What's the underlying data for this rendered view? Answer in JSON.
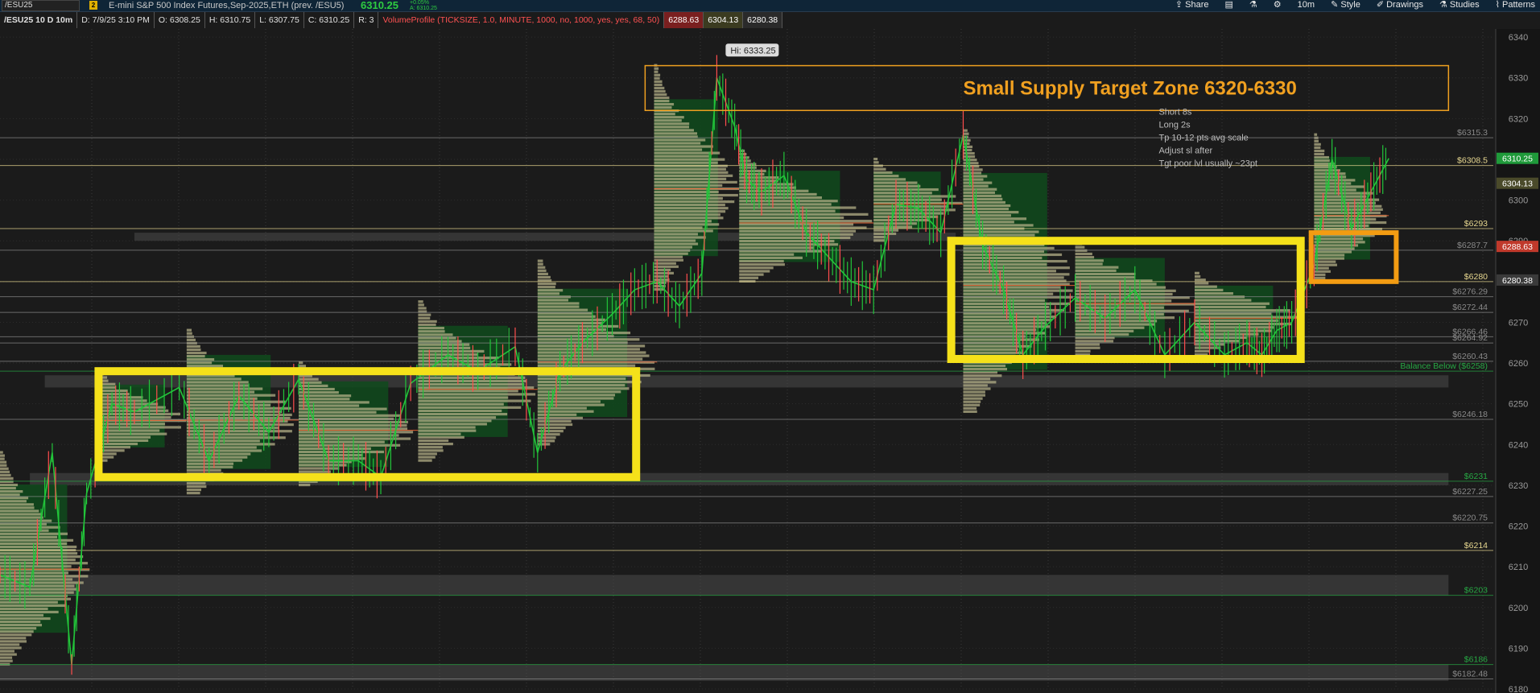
{
  "toolbar": {
    "symbol": "/ESU25",
    "badge": "2",
    "description": "E-mini S&P 500 Index Futures,Sep-2025,ETH (prev. /ESU5)",
    "last": "6310.25",
    "change_pct": "+0.05%",
    "ask": "A: 6310.25",
    "share": "Share",
    "timeframe": "10m",
    "style": "Style",
    "drawings": "Drawings",
    "studies": "Studies",
    "patterns": "Patterns"
  },
  "infobar": {
    "title": "/ESU25 10 D 10m",
    "date": "D: 7/9/25 3:10 PM",
    "open": "O: 6308.25",
    "high": "H: 6310.75",
    "low": "L: 6307.75",
    "close": "C: 6310.25",
    "range": "R: 3",
    "study": "VolumeProfile (TICKSIZE, 1.0, MINUTE, 1000, no, 1000, yes, yes, 68, 50)",
    "v1": "6288.63",
    "v2": "6304.13",
    "v3": "6280.38"
  },
  "annotations": {
    "zone_title": "Small Supply Target Zone 6320-6330",
    "hi_label": "Hi: 6333.25",
    "notes": [
      "Short 8s",
      "Long 2s",
      "Tp 10-12 pts avg scale",
      "Adjust sl after",
      "Tgt poor lvl usually ~23pt"
    ]
  },
  "chart_data": {
    "type": "candlestick",
    "instrument": "/ESU25",
    "timeframe": "10m",
    "ylim": [
      6180,
      6342
    ],
    "y_ticks": [
      6180,
      6190,
      6200,
      6210,
      6220,
      6230,
      6240,
      6250,
      6260,
      6270,
      6280,
      6290,
      6300,
      6310,
      6320,
      6330,
      6340
    ],
    "price_path": [
      [
        0.0,
        6208
      ],
      [
        0.02,
        6205
      ],
      [
        0.035,
        6238
      ],
      [
        0.048,
        6186
      ],
      [
        0.058,
        6228
      ],
      [
        0.075,
        6250
      ],
      [
        0.09,
        6248
      ],
      [
        0.12,
        6254
      ],
      [
        0.14,
        6236
      ],
      [
        0.16,
        6252
      ],
      [
        0.18,
        6243
      ],
      [
        0.2,
        6256
      ],
      [
        0.22,
        6236
      ],
      [
        0.24,
        6236
      ],
      [
        0.255,
        6232
      ],
      [
        0.275,
        6255
      ],
      [
        0.3,
        6262
      ],
      [
        0.32,
        6258
      ],
      [
        0.345,
        6264
      ],
      [
        0.36,
        6238
      ],
      [
        0.375,
        6258
      ],
      [
        0.39,
        6265
      ],
      [
        0.41,
        6272
      ],
      [
        0.425,
        6278
      ],
      [
        0.44,
        6280
      ],
      [
        0.455,
        6274
      ],
      [
        0.47,
        6282
      ],
      [
        0.48,
        6330
      ],
      [
        0.492,
        6318
      ],
      [
        0.5,
        6305
      ],
      [
        0.51,
        6302
      ],
      [
        0.525,
        6306
      ],
      [
        0.54,
        6292
      ],
      [
        0.555,
        6286
      ],
      [
        0.57,
        6280
      ],
      [
        0.585,
        6278
      ],
      [
        0.6,
        6299
      ],
      [
        0.615,
        6298
      ],
      [
        0.63,
        6292
      ],
      [
        0.645,
        6316
      ],
      [
        0.658,
        6289
      ],
      [
        0.672,
        6278
      ],
      [
        0.685,
        6262
      ],
      [
        0.7,
        6269
      ],
      [
        0.72,
        6276
      ],
      [
        0.74,
        6271
      ],
      [
        0.76,
        6278
      ],
      [
        0.78,
        6262
      ],
      [
        0.8,
        6270
      ],
      [
        0.82,
        6262
      ],
      [
        0.835,
        6265
      ],
      [
        0.845,
        6262
      ],
      [
        0.855,
        6268
      ],
      [
        0.865,
        6270
      ],
      [
        0.88,
        6284
      ],
      [
        0.892,
        6310
      ],
      [
        0.905,
        6293
      ],
      [
        0.918,
        6302
      ],
      [
        0.93,
        6310.25
      ]
    ],
    "high": 6333.25,
    "last": 6310.25,
    "levels": [
      {
        "label": "$6315.3",
        "value": 6315.3,
        "color": "#8a8a8a"
      },
      {
        "label": "$6308.5",
        "value": 6308.5,
        "color": "#e8d890"
      },
      {
        "label": "$6293",
        "value": 6293,
        "color": "#e8d890"
      },
      {
        "label": "$6287.7",
        "value": 6287.7,
        "color": "#8a8a8a"
      },
      {
        "label": "$6280",
        "value": 6280,
        "color": "#e8d890"
      },
      {
        "label": "$6276.29",
        "value": 6276.29,
        "color": "#8a8a8a"
      },
      {
        "label": "$6272.44",
        "value": 6272.44,
        "color": "#8a8a8a"
      },
      {
        "label": "$6266.46",
        "value": 6266.46,
        "color": "#8a8a8a"
      },
      {
        "label": "$6264.92",
        "value": 6264.92,
        "color": "#8a8a8a"
      },
      {
        "label": "$6260.43",
        "value": 6260.43,
        "color": "#8a8a8a"
      },
      {
        "label": "Balance Below ($6258)",
        "value": 6258,
        "color": "#27a844"
      },
      {
        "label": "$6246.18",
        "value": 6246.18,
        "color": "#8a8a8a"
      },
      {
        "label": "$6231",
        "value": 6231,
        "color": "#27a844"
      },
      {
        "label": "$6227.25",
        "value": 6227.25,
        "color": "#8a8a8a"
      },
      {
        "label": "$6220.75",
        "value": 6220.75,
        "color": "#8a8a8a"
      },
      {
        "label": "$6214",
        "value": 6214,
        "color": "#e8d890"
      },
      {
        "label": "$6203",
        "value": 6203,
        "color": "#27a844"
      },
      {
        "label": "$6186",
        "value": 6186,
        "color": "#27a844"
      },
      {
        "label": "$6182.48",
        "value": 6182.48,
        "color": "#8a8a8a"
      }
    ],
    "price_tags": [
      {
        "label": "6310.25",
        "value": 6310.25,
        "bg": "#1f9a3a"
      },
      {
        "label": "6304.13",
        "value": 6304.13,
        "bg": "#4a4a2a"
      },
      {
        "label": "6288.63",
        "value": 6288.63,
        "bg": "#c0392b"
      },
      {
        "label": "6280.38",
        "value": 6280.38,
        "bg": "#3a3a3a"
      }
    ],
    "zones": [
      {
        "type": "supply",
        "from": 6322,
        "to": 6333,
        "x0": 0.432,
        "x1": 0.97,
        "color": "#f0a020"
      },
      {
        "type": "balance",
        "from": 6232,
        "to": 6258,
        "x0": 0.066,
        "x1": 0.426,
        "color": "#f5e11a"
      },
      {
        "type": "balance",
        "from": 6261,
        "to": 6290,
        "x0": 0.637,
        "x1": 0.871,
        "color": "#f5e11a"
      },
      {
        "type": "balance",
        "from": 6280,
        "to": 6292,
        "x0": 0.878,
        "x1": 0.935,
        "color": "#f39c12"
      }
    ],
    "grey_bands": [
      {
        "from": 6290,
        "to": 6292,
        "x0": 0.09,
        "x1": 0.64
      },
      {
        "from": 6254,
        "to": 6257,
        "x0": 0.03,
        "x1": 0.97
      },
      {
        "from": 6230,
        "to": 6233,
        "x0": 0.02,
        "x1": 0.97
      },
      {
        "from": 6203,
        "to": 6208,
        "x0": 0.0,
        "x1": 0.97
      },
      {
        "from": 6182,
        "to": 6186,
        "x0": 0.0,
        "x1": 0.97
      }
    ]
  }
}
